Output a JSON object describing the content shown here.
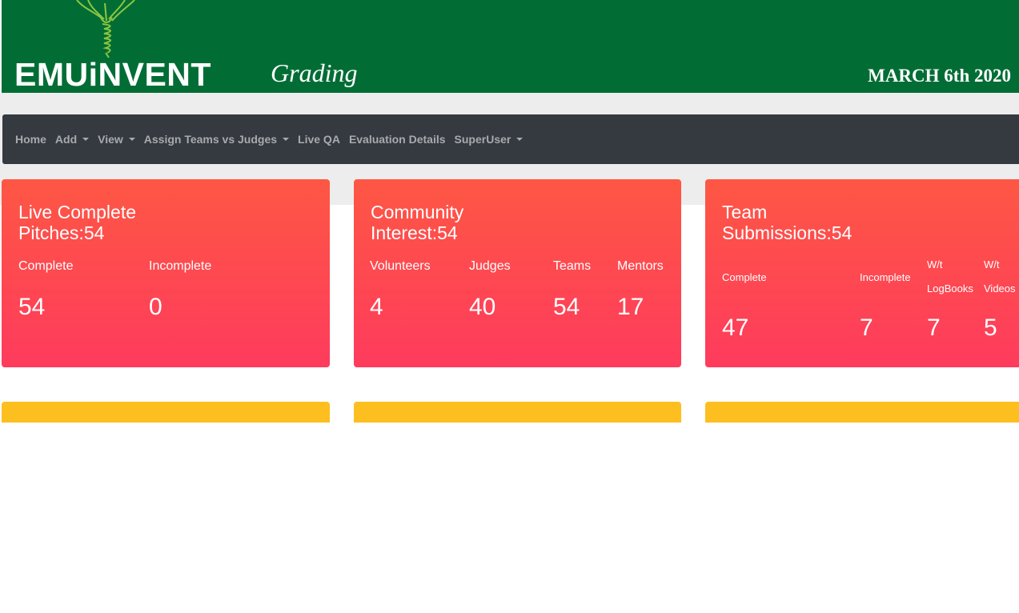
{
  "banner": {
    "logo": "EMUiNVENT",
    "subtitle": "Grading",
    "date": "MARCH 6th 2020",
    "bg_color": "#016d35"
  },
  "nav": {
    "items": [
      {
        "label": "Home",
        "dropdown": false
      },
      {
        "label": "Add",
        "dropdown": true
      },
      {
        "label": "View",
        "dropdown": true
      },
      {
        "label": "Assign Teams vs Judges",
        "dropdown": true
      },
      {
        "label": "Live QA",
        "dropdown": false
      },
      {
        "label": "Evaluation Details",
        "dropdown": false
      },
      {
        "label": "SuperUser",
        "dropdown": true
      }
    ]
  },
  "cards": {
    "live": {
      "title_line1": "Live Complete",
      "title_line2": "Pitches:54",
      "labels": [
        "Complete",
        "Incomplete"
      ],
      "values": [
        "54",
        "0"
      ]
    },
    "community": {
      "title_line1": "Community",
      "title_line2": "Interest:54",
      "labels": [
        "Volunteers",
        "Judges",
        "Teams",
        "Mentors"
      ],
      "values": [
        "4",
        "40",
        "54",
        "17"
      ]
    },
    "team": {
      "title_line1": "Team",
      "title_line2": "Submissions:54",
      "labels": {
        "complete": "Complete",
        "incomplete": "Incomplete",
        "logbooks_1": "W/t",
        "logbooks_2": "LogBooks",
        "videos_1": "W/t",
        "videos_2": "Videos"
      },
      "values": [
        "47",
        "7",
        "7",
        "5"
      ]
    }
  },
  "colors": {
    "nav_bg": "#343a40",
    "card_top": "#fe5744",
    "card_bottom": "#fe3b5d",
    "card_yellow": "#fdbe1f"
  }
}
